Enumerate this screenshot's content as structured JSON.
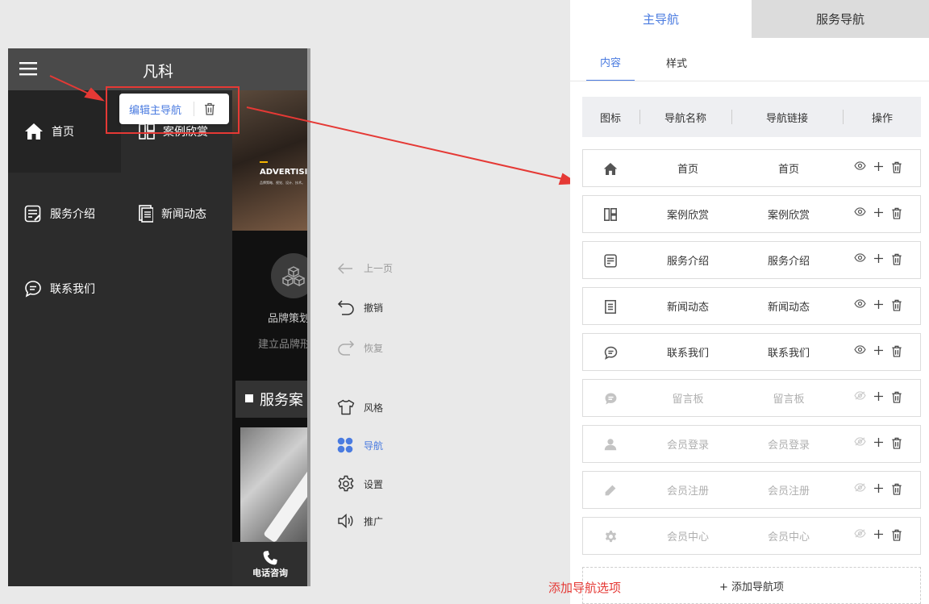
{
  "phone": {
    "title": "凡科",
    "nav": {
      "home": "首页",
      "cases": "案例欣赏",
      "service": "服务介绍",
      "news": "新闻动态",
      "contact": "联系我们"
    },
    "banner_text": "ADVERTISI",
    "banner_sub": "品牌策略、视觉、设计、技术。",
    "brand_title": "品牌策划",
    "brand_sub": "建立品牌形",
    "cases_title": "服务案",
    "call_label": "电话咨询",
    "popup": {
      "edit_label": "编辑主导航"
    }
  },
  "toolbar": {
    "prev": "上一页",
    "undo": "撤销",
    "redo": "恢复",
    "style": "风格",
    "nav": "导航",
    "settings": "设置",
    "promote": "推广"
  },
  "panel": {
    "tabs": {
      "main": "主导航",
      "service": "服务导航"
    },
    "subtabs": {
      "content": "内容",
      "style": "样式"
    },
    "columns": {
      "icon": "图标",
      "name": "导航名称",
      "link": "导航链接",
      "ops": "操作"
    },
    "rows": [
      {
        "icon": "home-icon",
        "name": "首页",
        "link": "首页",
        "visible": true
      },
      {
        "icon": "grid-icon",
        "name": "案例欣赏",
        "link": "案例欣赏",
        "visible": true
      },
      {
        "icon": "note-icon",
        "name": "服务介绍",
        "link": "服务介绍",
        "visible": true
      },
      {
        "icon": "doc-icon",
        "name": "新闻动态",
        "link": "新闻动态",
        "visible": true
      },
      {
        "icon": "chat-icon",
        "name": "联系我们",
        "link": "联系我们",
        "visible": true
      },
      {
        "icon": "message-icon",
        "name": "留言板",
        "link": "留言板",
        "visible": false
      },
      {
        "icon": "user-icon",
        "name": "会员登录",
        "link": "会员登录",
        "visible": false
      },
      {
        "icon": "pencil-icon",
        "name": "会员注册",
        "link": "会员注册",
        "visible": false
      },
      {
        "icon": "gear-icon",
        "name": "会员中心",
        "link": "会员中心",
        "visible": false
      }
    ],
    "add_label": "+ 添加导航项"
  },
  "annotation": {
    "add_note": "添加导航选项"
  },
  "colors": {
    "accent": "#4a7be0",
    "annotation": "#e53935",
    "phone_bg": "#2c2c2c"
  }
}
